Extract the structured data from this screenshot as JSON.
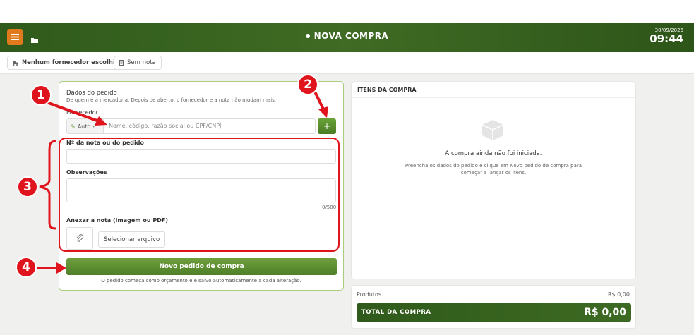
{
  "header": {
    "title": "NOVA COMPRA",
    "date": "30/09/2026",
    "time": "09:44",
    "menu_icon": "hamburger-icon",
    "folder_icon": "folder-icon"
  },
  "subbar": {
    "supplier_chip": "Nenhum fornecedor escolhido",
    "invoice_chip": "Sem nota"
  },
  "form": {
    "section_title": "Dados do pedido",
    "section_subtitle": "De quem é a mercadoria. Depois de aberto, o fornecedor e a nota não mudam mais.",
    "supplier_label": "Fornecedor",
    "auto_label": "Auto",
    "supplier_placeholder": "Nome, código, razão social ou CPF/CNPJ",
    "add_label": "+",
    "invoice_label": "Nº da nota ou do pedido",
    "notes_label": "Observações",
    "notes_counter": "0/500",
    "attach_label": "Anexar a nota (imagem ou PDF)",
    "select_file_label": "Selecionar arquivo",
    "submit_label": "Novo pedido de compra",
    "hint": "O pedido começa como orçamento e é salvo automaticamente a cada alteração."
  },
  "annotations": [
    "1",
    "2",
    "3",
    "4"
  ],
  "items_panel": {
    "title": "ITENS DA COMPRA",
    "empty_title": "A compra ainda não foi iniciada.",
    "empty_sub": "Preencha os dados do pedido e clique em Novo pedido de compra para começar a lançar os itens."
  },
  "totals": {
    "products_label": "Produtos",
    "products_value": "R$ 0,00",
    "total_label": "TOTAL DA COMPRA",
    "total_value": "R$ 0,00"
  },
  "colors": {
    "header_green": "#3f6b24",
    "menu_orange": "#e07a1c",
    "annotation_red": "#e0141c",
    "panel_border": "#a9cc7d"
  }
}
